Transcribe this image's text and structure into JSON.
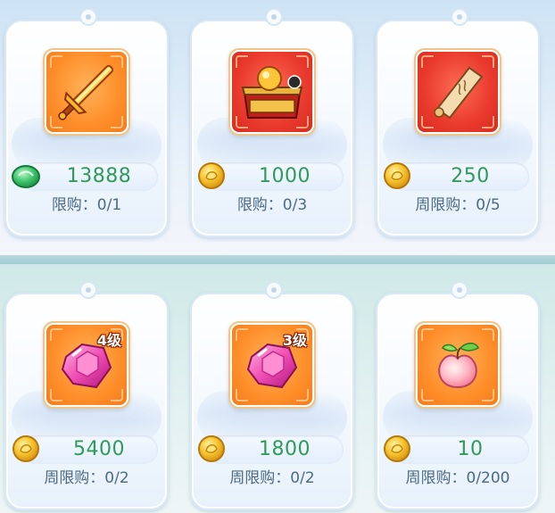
{
  "row1": [
    {
      "item": "golden-sword-icon",
      "currency": "jade-currency-icon",
      "price": "13888",
      "limit": "限购：0/1"
    },
    {
      "item": "treasure-chest-icon",
      "currency": "gold-coin-icon",
      "price": "1000",
      "limit": "限购：0/3"
    },
    {
      "item": "scroll-icon",
      "currency": "gold-coin-icon",
      "price": "250",
      "limit": "周限购：0/5"
    }
  ],
  "row2": [
    {
      "item": "pink-gem-icon",
      "badge": "4级",
      "currency": "gold-coin-icon",
      "price": "5400",
      "limit": "周限购：0/2"
    },
    {
      "item": "pink-gem-icon",
      "badge": "3级",
      "currency": "gold-coin-icon",
      "price": "1800",
      "limit": "周限购：0/2"
    },
    {
      "item": "peach-icon",
      "currency": "gold-coin-icon",
      "price": "10",
      "limit": "周限购：0/200"
    }
  ],
  "colors": {
    "price_text": "#2f9a5a",
    "limit_text": "#4b6a86",
    "slot_orange": "#ff8e2a",
    "slot_red": "#e93a2d",
    "badge_text": "#ffffff"
  }
}
